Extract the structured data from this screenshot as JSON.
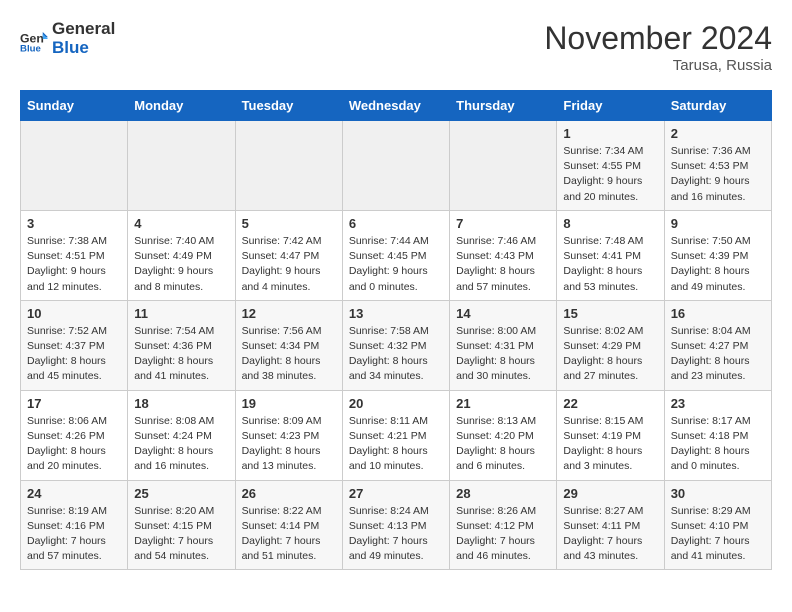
{
  "header": {
    "logo_line1": "General",
    "logo_line2": "Blue",
    "month_title": "November 2024",
    "location": "Tarusa, Russia"
  },
  "weekdays": [
    "Sunday",
    "Monday",
    "Tuesday",
    "Wednesday",
    "Thursday",
    "Friday",
    "Saturday"
  ],
  "weeks": [
    [
      {
        "day": "",
        "sunrise": "",
        "sunset": "",
        "daylight": "",
        "empty": true
      },
      {
        "day": "",
        "sunrise": "",
        "sunset": "",
        "daylight": "",
        "empty": true
      },
      {
        "day": "",
        "sunrise": "",
        "sunset": "",
        "daylight": "",
        "empty": true
      },
      {
        "day": "",
        "sunrise": "",
        "sunset": "",
        "daylight": "",
        "empty": true
      },
      {
        "day": "",
        "sunrise": "",
        "sunset": "",
        "daylight": "",
        "empty": true
      },
      {
        "day": "1",
        "sunrise": "Sunrise: 7:34 AM",
        "sunset": "Sunset: 4:55 PM",
        "daylight": "Daylight: 9 hours and 20 minutes."
      },
      {
        "day": "2",
        "sunrise": "Sunrise: 7:36 AM",
        "sunset": "Sunset: 4:53 PM",
        "daylight": "Daylight: 9 hours and 16 minutes."
      }
    ],
    [
      {
        "day": "3",
        "sunrise": "Sunrise: 7:38 AM",
        "sunset": "Sunset: 4:51 PM",
        "daylight": "Daylight: 9 hours and 12 minutes."
      },
      {
        "day": "4",
        "sunrise": "Sunrise: 7:40 AM",
        "sunset": "Sunset: 4:49 PM",
        "daylight": "Daylight: 9 hours and 8 minutes."
      },
      {
        "day": "5",
        "sunrise": "Sunrise: 7:42 AM",
        "sunset": "Sunset: 4:47 PM",
        "daylight": "Daylight: 9 hours and 4 minutes."
      },
      {
        "day": "6",
        "sunrise": "Sunrise: 7:44 AM",
        "sunset": "Sunset: 4:45 PM",
        "daylight": "Daylight: 9 hours and 0 minutes."
      },
      {
        "day": "7",
        "sunrise": "Sunrise: 7:46 AM",
        "sunset": "Sunset: 4:43 PM",
        "daylight": "Daylight: 8 hours and 57 minutes."
      },
      {
        "day": "8",
        "sunrise": "Sunrise: 7:48 AM",
        "sunset": "Sunset: 4:41 PM",
        "daylight": "Daylight: 8 hours and 53 minutes."
      },
      {
        "day": "9",
        "sunrise": "Sunrise: 7:50 AM",
        "sunset": "Sunset: 4:39 PM",
        "daylight": "Daylight: 8 hours and 49 minutes."
      }
    ],
    [
      {
        "day": "10",
        "sunrise": "Sunrise: 7:52 AM",
        "sunset": "Sunset: 4:37 PM",
        "daylight": "Daylight: 8 hours and 45 minutes."
      },
      {
        "day": "11",
        "sunrise": "Sunrise: 7:54 AM",
        "sunset": "Sunset: 4:36 PM",
        "daylight": "Daylight: 8 hours and 41 minutes."
      },
      {
        "day": "12",
        "sunrise": "Sunrise: 7:56 AM",
        "sunset": "Sunset: 4:34 PM",
        "daylight": "Daylight: 8 hours and 38 minutes."
      },
      {
        "day": "13",
        "sunrise": "Sunrise: 7:58 AM",
        "sunset": "Sunset: 4:32 PM",
        "daylight": "Daylight: 8 hours and 34 minutes."
      },
      {
        "day": "14",
        "sunrise": "Sunrise: 8:00 AM",
        "sunset": "Sunset: 4:31 PM",
        "daylight": "Daylight: 8 hours and 30 minutes."
      },
      {
        "day": "15",
        "sunrise": "Sunrise: 8:02 AM",
        "sunset": "Sunset: 4:29 PM",
        "daylight": "Daylight: 8 hours and 27 minutes."
      },
      {
        "day": "16",
        "sunrise": "Sunrise: 8:04 AM",
        "sunset": "Sunset: 4:27 PM",
        "daylight": "Daylight: 8 hours and 23 minutes."
      }
    ],
    [
      {
        "day": "17",
        "sunrise": "Sunrise: 8:06 AM",
        "sunset": "Sunset: 4:26 PM",
        "daylight": "Daylight: 8 hours and 20 minutes."
      },
      {
        "day": "18",
        "sunrise": "Sunrise: 8:08 AM",
        "sunset": "Sunset: 4:24 PM",
        "daylight": "Daylight: 8 hours and 16 minutes."
      },
      {
        "day": "19",
        "sunrise": "Sunrise: 8:09 AM",
        "sunset": "Sunset: 4:23 PM",
        "daylight": "Daylight: 8 hours and 13 minutes."
      },
      {
        "day": "20",
        "sunrise": "Sunrise: 8:11 AM",
        "sunset": "Sunset: 4:21 PM",
        "daylight": "Daylight: 8 hours and 10 minutes."
      },
      {
        "day": "21",
        "sunrise": "Sunrise: 8:13 AM",
        "sunset": "Sunset: 4:20 PM",
        "daylight": "Daylight: 8 hours and 6 minutes."
      },
      {
        "day": "22",
        "sunrise": "Sunrise: 8:15 AM",
        "sunset": "Sunset: 4:19 PM",
        "daylight": "Daylight: 8 hours and 3 minutes."
      },
      {
        "day": "23",
        "sunrise": "Sunrise: 8:17 AM",
        "sunset": "Sunset: 4:18 PM",
        "daylight": "Daylight: 8 hours and 0 minutes."
      }
    ],
    [
      {
        "day": "24",
        "sunrise": "Sunrise: 8:19 AM",
        "sunset": "Sunset: 4:16 PM",
        "daylight": "Daylight: 7 hours and 57 minutes."
      },
      {
        "day": "25",
        "sunrise": "Sunrise: 8:20 AM",
        "sunset": "Sunset: 4:15 PM",
        "daylight": "Daylight: 7 hours and 54 minutes."
      },
      {
        "day": "26",
        "sunrise": "Sunrise: 8:22 AM",
        "sunset": "Sunset: 4:14 PM",
        "daylight": "Daylight: 7 hours and 51 minutes."
      },
      {
        "day": "27",
        "sunrise": "Sunrise: 8:24 AM",
        "sunset": "Sunset: 4:13 PM",
        "daylight": "Daylight: 7 hours and 49 minutes."
      },
      {
        "day": "28",
        "sunrise": "Sunrise: 8:26 AM",
        "sunset": "Sunset: 4:12 PM",
        "daylight": "Daylight: 7 hours and 46 minutes."
      },
      {
        "day": "29",
        "sunrise": "Sunrise: 8:27 AM",
        "sunset": "Sunset: 4:11 PM",
        "daylight": "Daylight: 7 hours and 43 minutes."
      },
      {
        "day": "30",
        "sunrise": "Sunrise: 8:29 AM",
        "sunset": "Sunset: 4:10 PM",
        "daylight": "Daylight: 7 hours and 41 minutes."
      }
    ]
  ]
}
